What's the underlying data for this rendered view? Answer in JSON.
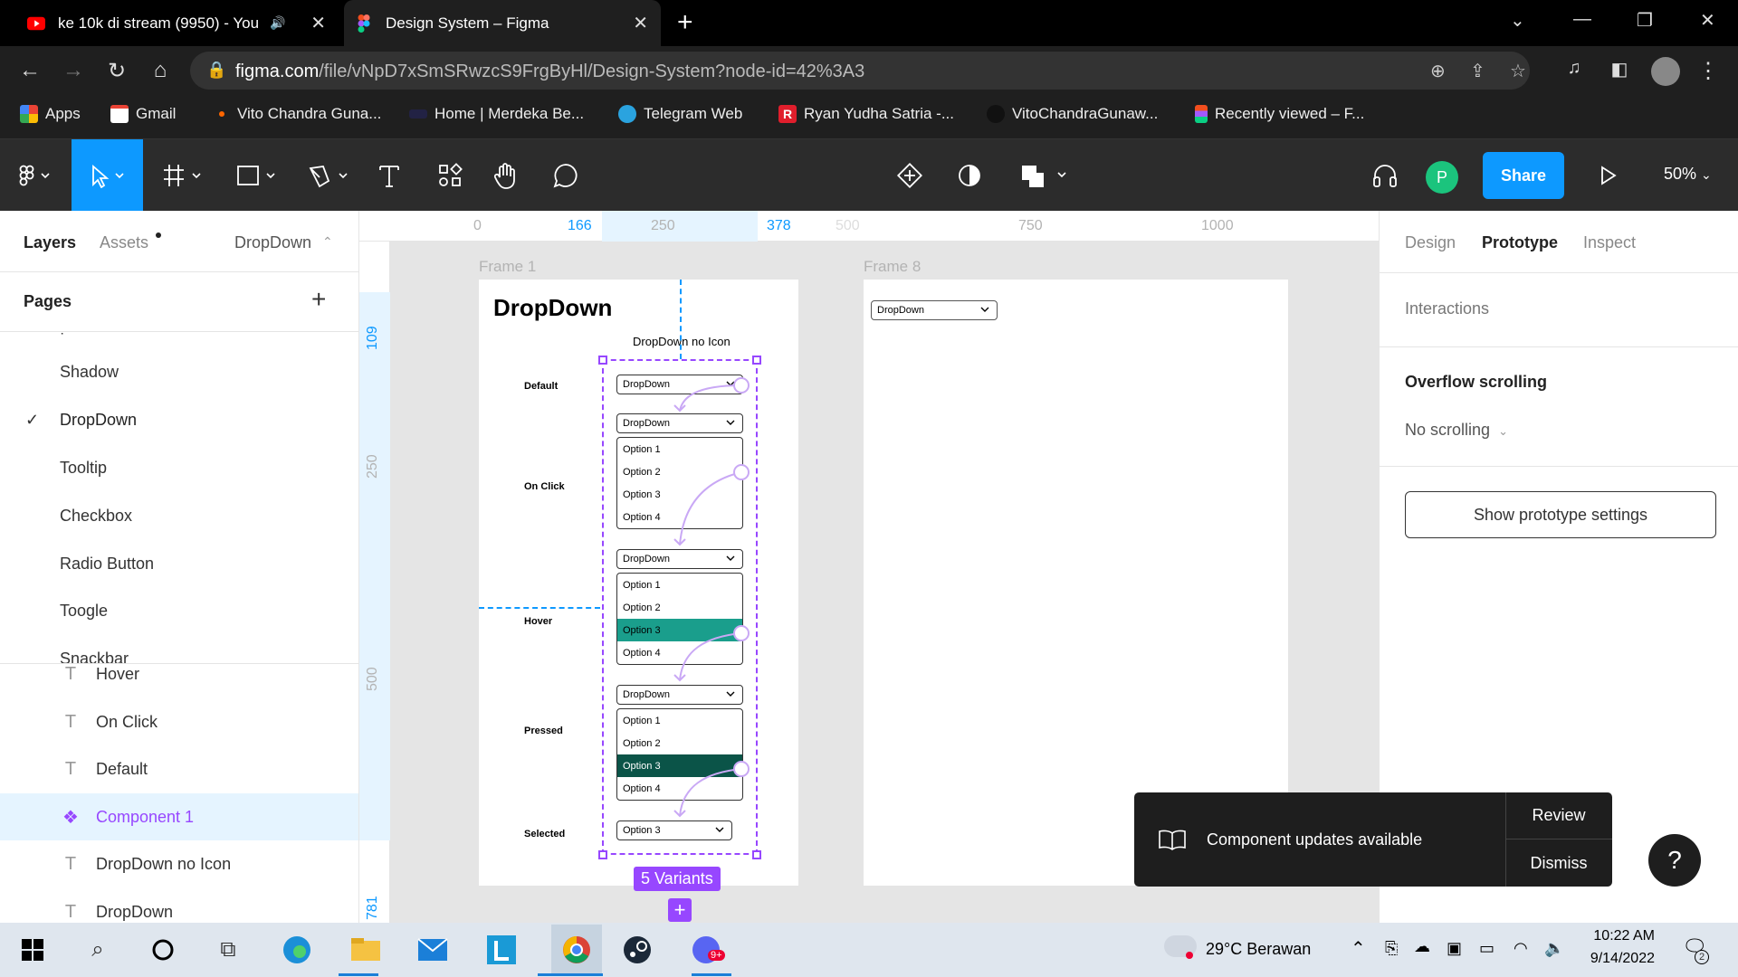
{
  "browser": {
    "tabs": [
      {
        "title": "ke 10k di stream (9950) - You"
      },
      {
        "title": "Design System – Figma"
      }
    ],
    "url_domain": "figma.com",
    "url_path": "/file/vNpD7xSmSRwzcS9FrgByHl/Design-System?node-id=42%3A3",
    "bookmarks": [
      {
        "label": "Apps"
      },
      {
        "label": "Gmail"
      },
      {
        "label": "Vito Chandra Guna..."
      },
      {
        "label": "Home | Merdeka Be..."
      },
      {
        "label": "Telegram Web"
      },
      {
        "label": "Ryan Yudha Satria -..."
      },
      {
        "label": "VitoChandraGunaw..."
      },
      {
        "label": "Recently viewed – F..."
      }
    ]
  },
  "toolbar": {
    "share_label": "Share",
    "avatar_initial": "P",
    "zoom": "50%"
  },
  "left_panel": {
    "tabs": {
      "layers": "Layers",
      "assets": "Assets",
      "page_selector": "DropDown"
    },
    "pages_title": "Pages",
    "pages": [
      "Shadow",
      "DropDown",
      "Tooltip",
      "Checkbox",
      "Radio Button",
      "Toogle",
      "Snackbar"
    ],
    "layers": [
      {
        "label": "Hover",
        "type": "text"
      },
      {
        "label": "On Click",
        "type": "text"
      },
      {
        "label": "Default",
        "type": "text"
      },
      {
        "label": "Component 1",
        "type": "component"
      },
      {
        "label": "DropDown no Icon",
        "type": "text"
      },
      {
        "label": "DropDown",
        "type": "text"
      }
    ]
  },
  "canvas": {
    "ruler_top": [
      "0",
      "166",
      "250",
      "378",
      "500",
      "750",
      "1000"
    ],
    "ruler_left": [
      "109",
      "250",
      "500",
      "781"
    ],
    "frame1_label": "Frame 1",
    "frame8_label": "Frame 8",
    "heading": "DropDown",
    "subheading": "DropDown no Icon",
    "states": [
      "Default",
      "On Click",
      "Hover",
      "Pressed",
      "Selected"
    ],
    "dropdown_label": "DropDown",
    "options": [
      "Option 1",
      "Option 2",
      "Option 3",
      "Option 4"
    ],
    "selected_value": "Option 3",
    "variants_badge": "5 Variants",
    "frame8_dropdown": "DropDown"
  },
  "right_panel": {
    "tabs": {
      "design": "Design",
      "prototype": "Prototype",
      "inspect": "Inspect"
    },
    "interactions": "Interactions",
    "overflow_title": "Overflow scrolling",
    "overflow_value": "No scrolling",
    "show_settings": "Show prototype settings"
  },
  "toast": {
    "message": "Component updates available",
    "review": "Review",
    "dismiss": "Dismiss",
    "help": "?"
  },
  "taskbar": {
    "weather": "29°C  Berawan",
    "time": "10:22 AM",
    "date": "9/14/2022",
    "notif_count": "2",
    "badge": "9+"
  },
  "colors": {
    "accent_blue": "#0d99ff",
    "component_purple": "#9747ff",
    "hover_teal": "#1a9e8c",
    "pressed_green": "#0b5448"
  }
}
